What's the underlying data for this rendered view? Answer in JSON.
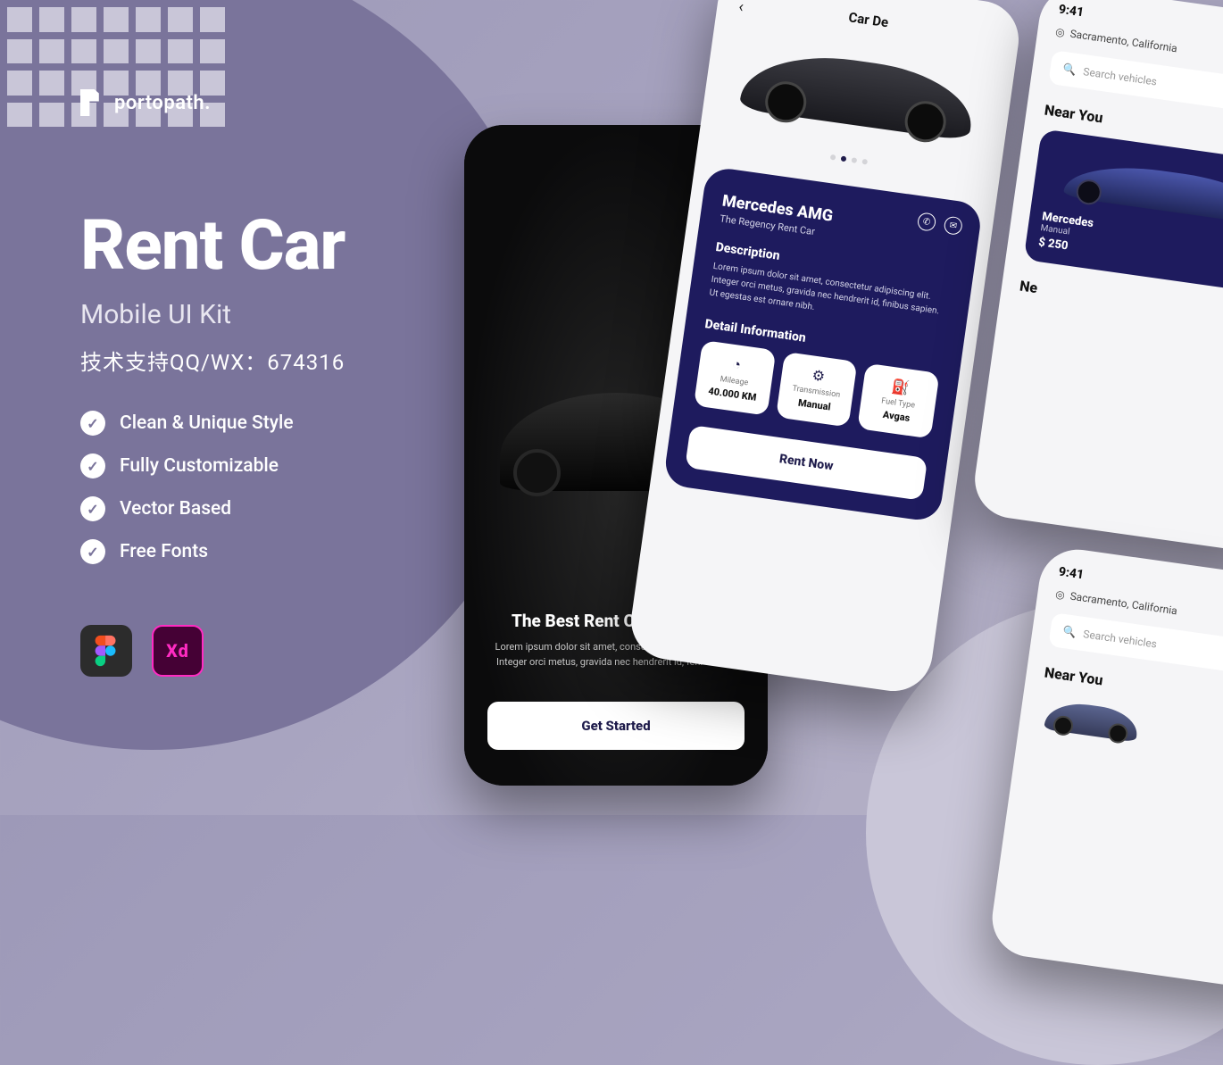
{
  "brand": {
    "name": "portopath."
  },
  "hero": {
    "title": "Rent Car",
    "subtitle": "Mobile UI Kit",
    "support": "技术支持QQ/WX：674316"
  },
  "features": [
    "Clean & Unique Style",
    "Fully Customizable",
    "Vector Based",
    "Free Fonts"
  ],
  "tools": {
    "figma": "Figma",
    "xd": "Xd"
  },
  "onboarding": {
    "title": "The Best Rent Car Services",
    "description": "Lorem ipsum dolor sit amet, consectetur adipiscing elit. Integer orci metus, gravida nec hendrerit id, feni are not",
    "cta": "Get Started"
  },
  "detail": {
    "header": "Car De",
    "name": "Mercedes AMG",
    "vendor": "The Regency Rent Car",
    "description_label": "Description",
    "description": "Lorem ipsum dolor sit amet, consectetur adipiscing elit. Integer orci metus, gravida nec hendrerit id, finibus sapien. Ut egestas est ornare nibh.",
    "info_label": "Detail Information",
    "mileage": {
      "label": "Mileage",
      "value": "40.000 KM"
    },
    "transmission": {
      "label": "Transmission",
      "value": "Manual"
    },
    "fuel": {
      "label": "Fuel Type",
      "value": "Avgas"
    },
    "rent_cta": "Rent Now"
  },
  "home1": {
    "time": "9:41",
    "location": "Sacramento, California",
    "search_placeholder": "Search vehicles",
    "near_you": "Near You",
    "card": {
      "name": "Mercedes",
      "sub": "Manual",
      "price": "$ 250"
    },
    "ne_label": "Ne"
  },
  "home2": {
    "time": "9:41",
    "location": "Sacramento, California",
    "search_placeholder": "Search vehicles",
    "near_you": "Near You"
  }
}
